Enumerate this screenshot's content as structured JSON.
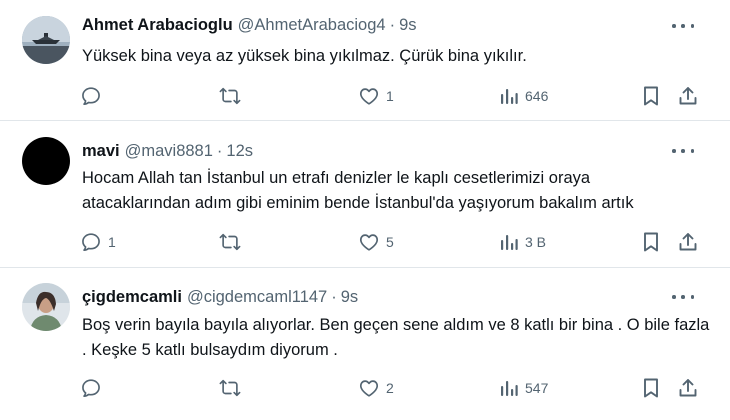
{
  "tweets": [
    {
      "name": "Ahmet Arabacioglu",
      "handle": "@AhmetArabaciog4",
      "separator": "·",
      "time": "9s",
      "text": "Yüksek bina veya az yüksek bina  yıkılmaz. Çürük bina yıkılır.",
      "replies": "",
      "retweets": "",
      "likes": "1",
      "views": "646"
    },
    {
      "name": "mavi",
      "handle": "@mavi8881",
      "separator": "·",
      "time": "12s",
      "text": "Hocam Allah tan İstanbul un etrafı denizler le kaplı cesetlerimizi oraya atacaklarından adım gibi eminim bende İstanbul'da yaşıyorum bakalım artık",
      "replies": "1",
      "retweets": "",
      "likes": "5",
      "views": "3 B"
    },
    {
      "name": "çigdemcamli",
      "handle": "@cigdemcaml1147",
      "separator": "·",
      "time": "9s",
      "text": "Boş verin bayıla bayıla alıyorlar.   Ben geçen sene aldım ve 8 katlı bir bina . O bile fazla . Keşke 5 katlı bulsaydım diyorum .",
      "replies": "",
      "retweets": "",
      "likes": "2",
      "views": "547"
    }
  ],
  "icons": {
    "reply": "reply-icon",
    "retweet": "retweet-icon",
    "like": "heart-icon",
    "views": "views-icon",
    "bookmark": "bookmark-icon",
    "share": "share-icon",
    "more": "more-icon"
  },
  "colors": {
    "text": "#0f1419",
    "secondary": "#536471",
    "divider": "#e1e6ea"
  }
}
